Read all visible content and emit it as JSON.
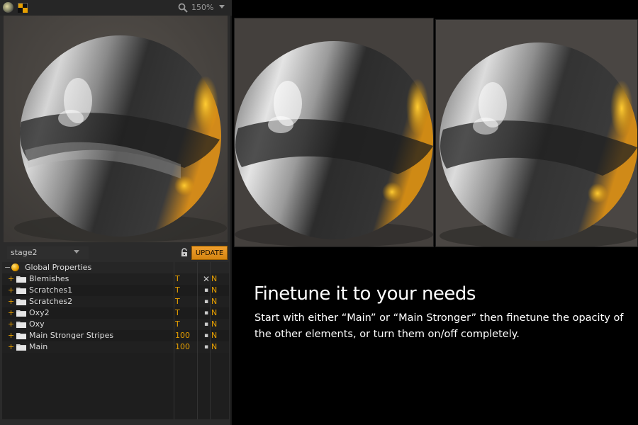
{
  "toolbar": {
    "zoom_label": "150%"
  },
  "stage": {
    "selected": "stage2",
    "update_label": "UPDATE"
  },
  "layers": {
    "global": {
      "label": "Global Properties"
    },
    "items": [
      {
        "name": "Blemishes",
        "value": "T",
        "visible": false,
        "flag": "N"
      },
      {
        "name": "Scratches1",
        "value": "T",
        "visible": true,
        "flag": "N"
      },
      {
        "name": "Scratches2",
        "value": "T",
        "visible": true,
        "flag": "N"
      },
      {
        "name": "Oxy2",
        "value": "T",
        "visible": true,
        "flag": "N"
      },
      {
        "name": "Oxy",
        "value": "T",
        "visible": true,
        "flag": "N"
      },
      {
        "name": "Main Stronger Stripes",
        "value": "100",
        "visible": true,
        "flag": "N"
      },
      {
        "name": "Main",
        "value": "100",
        "visible": true,
        "flag": "N"
      }
    ],
    "expand_symbol": "+",
    "collapse_symbol": "−",
    "visible_symbol": "▪",
    "hidden_symbol": "✕"
  },
  "caption": {
    "heading": "Finetune it to your needs",
    "body": "Start with either “Main” or “Main Stronger” then finetune the opacity of the other elements, or turn them on/off completely."
  },
  "colors": {
    "accent": "#e8a000",
    "panel": "#2b2b2b",
    "background": "#000000"
  },
  "icons": {
    "top_left": "render-ball-icon",
    "checker": "checker-icon",
    "zoom": "magnifier-icon",
    "lock": "lock-icon",
    "folder": "folder-icon"
  }
}
